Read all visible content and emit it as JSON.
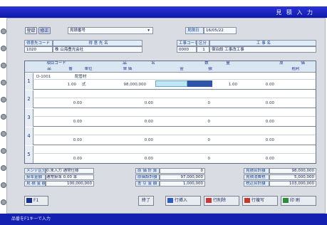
{
  "window": {
    "title": "見 積 入 力"
  },
  "toolbar": {
    "tabs": [
      "登録",
      "修正"
    ],
    "mode_label": "見積番号",
    "date_label": "見積日",
    "date_value": "16/05/22"
  },
  "header": {
    "customer_code_label": "得意先コード",
    "customer_name_label": "得 意 先 名",
    "customer_code": "1020",
    "customer_name": "株 山海豊光会社",
    "project_code_label": "工事コード",
    "project_name_label": "工 事 名",
    "class_label": "区分",
    "project_code": "0000",
    "class_value": "1",
    "project_name": "宿泊設 工事改工事"
  },
  "table": {
    "headers_top": [
      "項目コード",
      "品",
      "名",
      "数",
      "量",
      "原",
      "価"
    ],
    "headers_bottom": [
      "品",
      "番",
      "単位",
      "単 価",
      "金",
      "額",
      "粗利"
    ],
    "rows": [
      {
        "num": "1",
        "code": "D-1001",
        "item": "配管材",
        "qty": "1.00",
        "unit": "式",
        "price": "98,000,000",
        "amount": "",
        "margin": "1.00",
        "cost": "0.00"
      },
      {
        "num": "2",
        "code": "",
        "item": "",
        "qty": "0.00",
        "unit": "",
        "price": "0.00",
        "amount": "0",
        "margin": "",
        "cost": "0.00"
      },
      {
        "num": "3",
        "code": "",
        "item": "",
        "qty": "0.00",
        "unit": "",
        "price": "0.00",
        "amount": "0",
        "margin": "",
        "cost": "0.00"
      },
      {
        "num": "4",
        "code": "",
        "item": "",
        "qty": "0.00",
        "unit": "",
        "price": "0.00",
        "amount": "0",
        "margin": "",
        "cost": "0.00"
      },
      {
        "num": "5",
        "code": "",
        "item": "",
        "qty": "0.00",
        "unit": "",
        "price": "0.00",
        "amount": "0",
        "margin": "",
        "cost": "0.00"
      }
    ]
  },
  "summary": {
    "left": [
      {
        "label": "メンテ区分",
        "value": "0:未入力 通常仕様"
      },
      {
        "label": "掛率金額",
        "value": "通常掛率 0.00 率"
      },
      {
        "label": "見 積 金 額",
        "value": "100,000,000"
      }
    ],
    "middle": [
      {
        "label": "原 価 計 算",
        "value": "0"
      },
      {
        "label": "原価設計額",
        "value": "97,000,000"
      },
      {
        "label": "差 引 金 額",
        "value": "1,000,000"
      }
    ],
    "right": [
      {
        "label": "見積合計額",
        "value": "98,000,000"
      },
      {
        "label": "見積消費税",
        "value": "5,000,000"
      },
      {
        "label": "税込合計額",
        "value": "103,000,000"
      }
    ]
  },
  "footer": {
    "f1": "F1",
    "center_button": "終了",
    "buttons": [
      "行挿入",
      "行削除",
      "行複写",
      "印 刷"
    ]
  },
  "status": {
    "text": "品番をF1キーで入力"
  }
}
